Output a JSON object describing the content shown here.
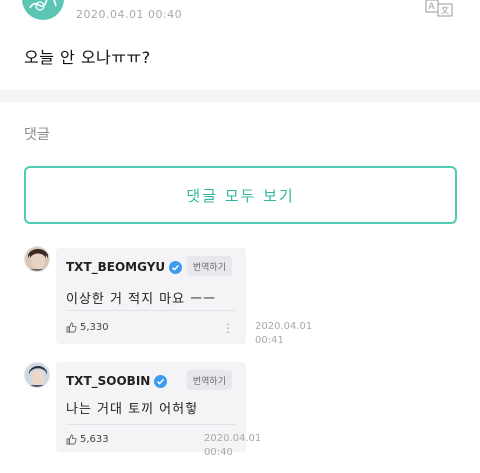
{
  "post": {
    "timestamp": "2020.04.01 00:40",
    "body": "오늘 안 오나ㅠㅠ?",
    "translate_icon": "translate-icon"
  },
  "comments_section": {
    "title": "댓글",
    "view_all_label": "댓글 모두 보기"
  },
  "comments": [
    {
      "author": "TXT_BEOMGYU",
      "verified": true,
      "translate_label": "번역하기",
      "text": "이상한 거 적지 마요 ㅡㅡ",
      "likes": "5,330",
      "time_date": "2020.04.01",
      "time_clock": "00:41"
    },
    {
      "author": "TXT_SOOBIN",
      "verified": true,
      "translate_label": "번역하기",
      "text": "나는 거대 토끼 어허헣",
      "likes": "5,633",
      "time_date": "2020.04.01",
      "time_clock": "00:40"
    }
  ],
  "colors": {
    "accent": "#4fcdb4",
    "accent_text": "#2fb89c",
    "verified": "#3d9bf0",
    "card_bg": "#f4f4f6"
  }
}
